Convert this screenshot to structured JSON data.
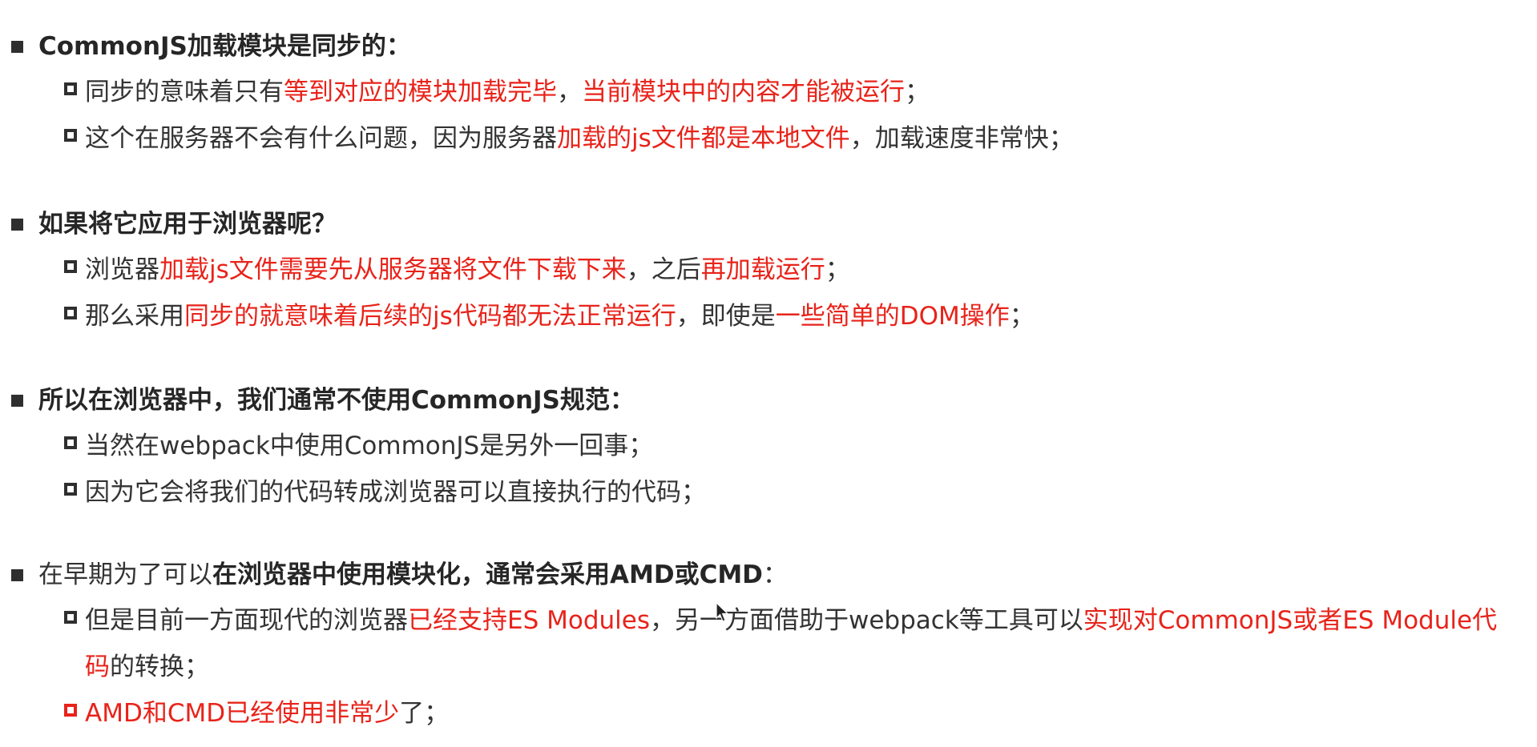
{
  "sections": [
    {
      "heading": [
        {
          "text": "CommonJS加载模块是同步的：",
          "style": "bold"
        }
      ],
      "items": [
        {
          "box": "normal",
          "segments": [
            {
              "text": "同步的意味着只有",
              "style": "normal"
            },
            {
              "text": "等到对应的模块加载完毕",
              "style": "red"
            },
            {
              "text": "，",
              "style": "normal"
            },
            {
              "text": "当前模块中的内容才能被运行",
              "style": "red"
            },
            {
              "text": "；",
              "style": "normal"
            }
          ]
        },
        {
          "box": "normal",
          "segments": [
            {
              "text": "这个在服务器不会有什么问题，因为服务器",
              "style": "normal"
            },
            {
              "text": "加载的js文件都是本地文件",
              "style": "red"
            },
            {
              "text": "，加载速度非常快；",
              "style": "normal"
            }
          ]
        }
      ]
    },
    {
      "heading": [
        {
          "text": "如果将它应用于浏览器呢？",
          "style": "bold"
        }
      ],
      "items": [
        {
          "box": "normal",
          "segments": [
            {
              "text": "浏览器",
              "style": "normal"
            },
            {
              "text": "加载js文件需要先从服务器将文件下载下来",
              "style": "red"
            },
            {
              "text": "，之后",
              "style": "normal"
            },
            {
              "text": "再加载运行",
              "style": "red"
            },
            {
              "text": "；",
              "style": "normal"
            }
          ]
        },
        {
          "box": "normal",
          "segments": [
            {
              "text": "那么采用",
              "style": "normal"
            },
            {
              "text": "同步的就意味着后续的js代码都无法正常运行",
              "style": "red"
            },
            {
              "text": "，即使是",
              "style": "normal"
            },
            {
              "text": "一些简单的DOM操作",
              "style": "red"
            },
            {
              "text": "；",
              "style": "normal"
            }
          ]
        }
      ]
    },
    {
      "heading": [
        {
          "text": "所以在浏览器中，我们通常不使用CommonJS规范：",
          "style": "bold"
        }
      ],
      "items": [
        {
          "box": "normal",
          "segments": [
            {
              "text": "当然在webpack中使用CommonJS是另外一回事；",
              "style": "normal"
            }
          ]
        },
        {
          "box": "normal",
          "segments": [
            {
              "text": "因为它会将我们的代码转成浏览器可以直接执行的代码；",
              "style": "normal"
            }
          ]
        }
      ]
    },
    {
      "heading": [
        {
          "text": "在早期为了可以",
          "style": "normal"
        },
        {
          "text": "在浏览器中使用模块化，通常会采用AMD或CMD",
          "style": "bold"
        },
        {
          "text": "：",
          "style": "normal"
        }
      ],
      "items": [
        {
          "box": "normal",
          "segments": [
            {
              "text": "但是目前一方面现代的浏览器",
              "style": "normal"
            },
            {
              "text": "已经支持ES Modules",
              "style": "red"
            },
            {
              "text": "，另一方面借助于webpack等工具可以",
              "style": "normal"
            },
            {
              "text": "实现对CommonJS或者ES Module代码",
              "style": "red"
            },
            {
              "text": "的转换；",
              "style": "normal"
            }
          ]
        },
        {
          "box": "red",
          "segments": [
            {
              "text": "AMD和CMD已经使用非常少",
              "style": "red"
            },
            {
              "text": "了；",
              "style": "normal"
            }
          ]
        }
      ]
    }
  ]
}
